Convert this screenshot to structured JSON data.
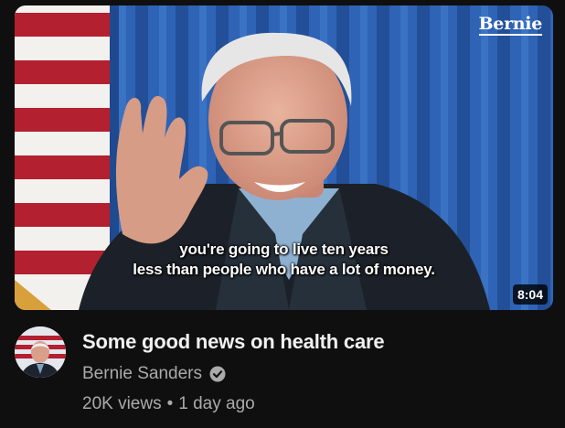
{
  "video": {
    "watermark": "Bernie",
    "caption_line1": "you're going to live ten years",
    "caption_line2": "less than people who have a lot of money.",
    "duration": "8:04",
    "title": "Some good news on health care"
  },
  "channel": {
    "name": "Bernie Sanders",
    "verified_icon": "verified-check-icon"
  },
  "stats": {
    "views": "20K views",
    "separator": "•",
    "age": "1 day ago"
  }
}
